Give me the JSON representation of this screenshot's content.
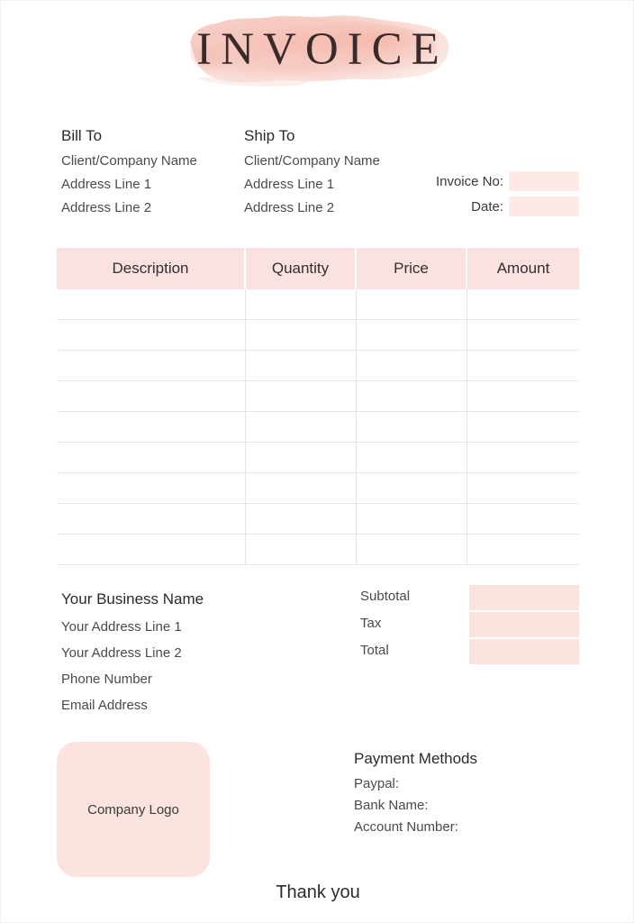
{
  "document": {
    "title": "INVOICE",
    "accent_pink": "#fbe2e0",
    "field_pink": "#fdeae7",
    "logo_pink": "#fbe3df"
  },
  "bill_to": {
    "title": "Bill To",
    "lines": [
      "Client/Company Name",
      "Address Line 1",
      "Address Line 2"
    ]
  },
  "ship_to": {
    "title": "Ship To",
    "lines": [
      "Client/Company Name",
      "Address Line 1",
      "Address Line 2"
    ]
  },
  "meta": {
    "invoice_no_label": "Invoice No:",
    "invoice_no_value": "",
    "date_label": "Date:",
    "date_value": ""
  },
  "table": {
    "headers": [
      "Description",
      "Quantity",
      "Price",
      "Amount"
    ],
    "rows": [
      [
        "",
        "",
        "",
        ""
      ],
      [
        "",
        "",
        "",
        ""
      ],
      [
        "",
        "",
        "",
        ""
      ],
      [
        "",
        "",
        "",
        ""
      ],
      [
        "",
        "",
        "",
        ""
      ],
      [
        "",
        "",
        "",
        ""
      ],
      [
        "",
        "",
        "",
        ""
      ],
      [
        "",
        "",
        "",
        ""
      ],
      [
        "",
        "",
        "",
        ""
      ]
    ]
  },
  "business": {
    "name": "Your Business Name",
    "lines": [
      "Your Address Line 1",
      "Your Address Line 2",
      "Phone Number",
      "Email Address"
    ]
  },
  "totals": {
    "rows": [
      {
        "label": "Subtotal",
        "value": ""
      },
      {
        "label": "Tax",
        "value": ""
      },
      {
        "label": "Total",
        "value": ""
      }
    ]
  },
  "logo": {
    "label": "Company Logo"
  },
  "payment": {
    "title": "Payment Methods",
    "lines": [
      "Paypal:",
      "Bank Name:",
      "Account Number:"
    ]
  },
  "footer": {
    "thank_you": "Thank you"
  }
}
